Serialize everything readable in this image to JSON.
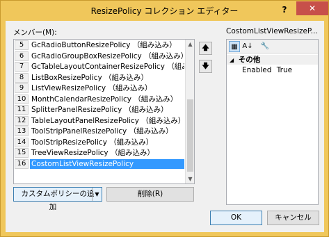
{
  "window": {
    "title": "ResizePolicy コレクション エディター",
    "help_glyph": "?",
    "close_glyph": "✕"
  },
  "members": {
    "label": "メンバー(M):",
    "items": [
      {
        "index": "5",
        "name": "GcRadioButtonResizePolicy （組み込み）",
        "selected": false
      },
      {
        "index": "6",
        "name": "GcRadioGroupBoxResizePolicy （組み込み）",
        "selected": false
      },
      {
        "index": "7",
        "name": "GcTableLayoutContainerResizePolicy （組み込み）",
        "selected": false
      },
      {
        "index": "8",
        "name": "ListBoxResizePolicy （組み込み）",
        "selected": false
      },
      {
        "index": "9",
        "name": "ListViewResizePolicy （組み込み）",
        "selected": false
      },
      {
        "index": "10",
        "name": "MonthCalendarResizePolicy （組み込み）",
        "selected": false
      },
      {
        "index": "11",
        "name": "SplitterPanelResizePolicy （組み込み）",
        "selected": false
      },
      {
        "index": "12",
        "name": "TableLayoutPanelResizePolicy （組み込み）",
        "selected": false
      },
      {
        "index": "13",
        "name": "ToolStripPanelResizePolicy （組み込み）",
        "selected": false
      },
      {
        "index": "14",
        "name": "ToolStripResizePolicy （組み込み）",
        "selected": false
      },
      {
        "index": "15",
        "name": "TreeViewResizePolicy （組み込み）",
        "selected": false
      },
      {
        "index": "16",
        "name": "CostomListViewResizePolicy",
        "selected": true
      }
    ]
  },
  "move": {
    "up_glyph": "🡅",
    "down_glyph": "🡇"
  },
  "properties": {
    "label": "CostomListViewResizeP...",
    "category": "その他",
    "collapse_glyph": "◢",
    "rows": [
      {
        "name": "Enabled",
        "value": "True"
      }
    ],
    "tools": {
      "categorized": "▦",
      "alphabetical": "A↓",
      "property_pages": "🔧"
    }
  },
  "buttons": {
    "add": "カスタムポリシーの追加",
    "add_arrow": "▼",
    "remove": "削除(R)",
    "ok": "OK",
    "cancel": "キャンセル"
  }
}
